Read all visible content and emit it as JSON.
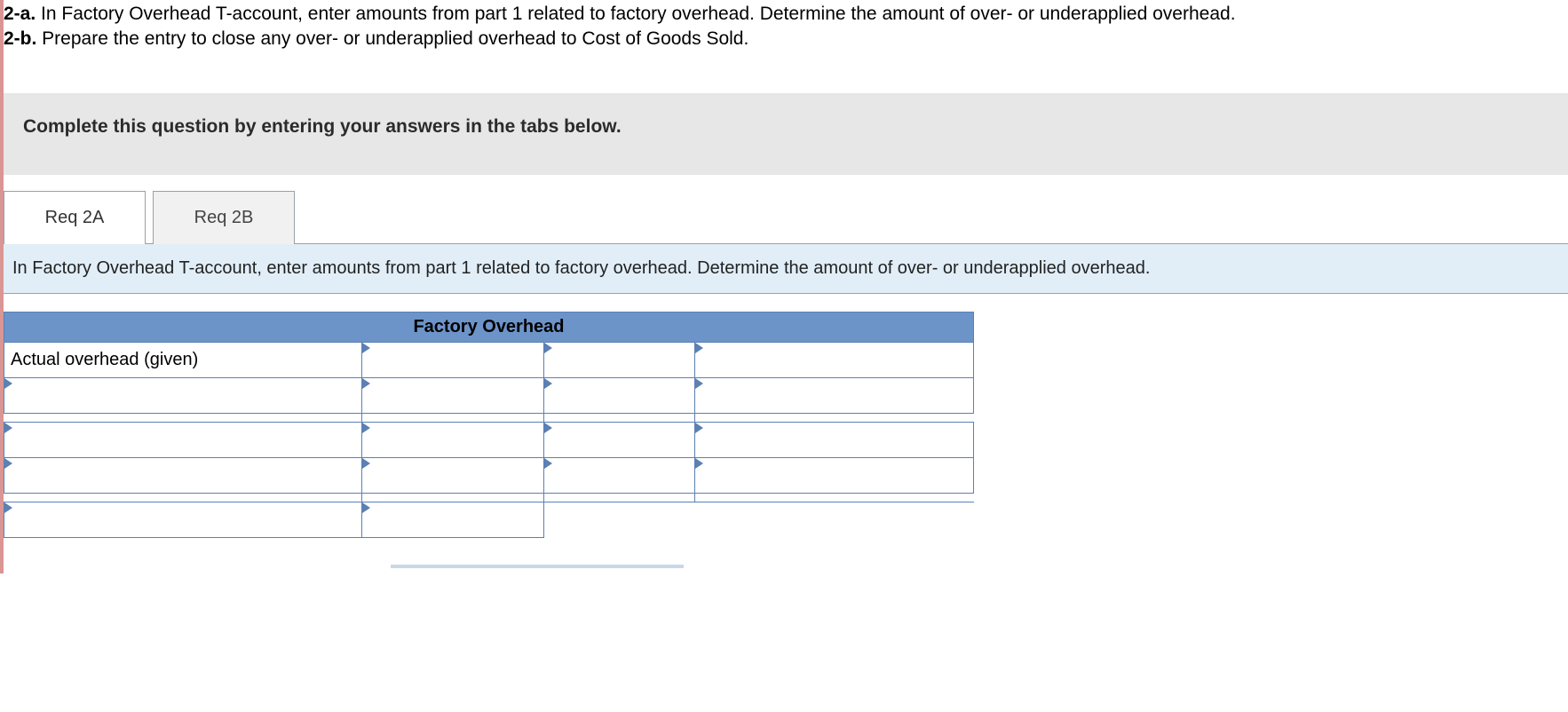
{
  "question": {
    "part_a_num": "2-a.",
    "part_a_text": " In Factory Overhead T-account, enter amounts from part 1 related to factory overhead. Determine the amount of over- or underapplied overhead.",
    "part_b_num": "2-b.",
    "part_b_text": " Prepare the entry to close any over- or underapplied overhead to Cost of Goods Sold."
  },
  "instruction": "Complete this question by entering your answers in the tabs below.",
  "tabs": [
    {
      "label": "Req 2A",
      "active": true
    },
    {
      "label": "Req 2B",
      "active": false
    }
  ],
  "panel_prompt": "In Factory Overhead T-account, enter amounts from part 1 related to factory overhead. Determine the amount of over- or underapplied overhead.",
  "taccount": {
    "title": "Factory Overhead",
    "rows": [
      {
        "label": "Actual overhead (given)",
        "amt1": "",
        "amt2": "",
        "amt3": "",
        "label_editable": false
      },
      {
        "label": "",
        "amt1": "",
        "amt2": "",
        "amt3": "",
        "label_editable": true
      },
      {
        "label": "",
        "amt1": "",
        "amt2": "",
        "amt3": "",
        "label_editable": true
      },
      {
        "label": "",
        "amt1": "",
        "amt2": "",
        "amt3": "",
        "label_editable": true
      }
    ],
    "footer": {
      "label": "",
      "amt1": "",
      "amt2": "",
      "amt3": ""
    }
  }
}
